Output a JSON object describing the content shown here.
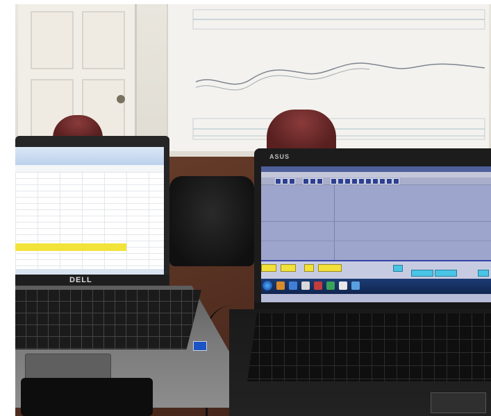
{
  "scene": {
    "description_tags": [
      "office-room",
      "two-laptops",
      "wooden-table"
    ]
  },
  "left_laptop": {
    "brand": "DELL",
    "screen": {
      "app": "spreadsheet",
      "cell_note": ""
    }
  },
  "right_laptop": {
    "brand": "ASUS",
    "screen": {
      "app": "signal-plot",
      "taskbar_clock": ""
    }
  },
  "colors": {
    "table": "#5a3322",
    "spreadsheet_highlight": "#f2e33a",
    "plot_background": "#9ea5cc",
    "taskbar": "#1c3b74"
  }
}
